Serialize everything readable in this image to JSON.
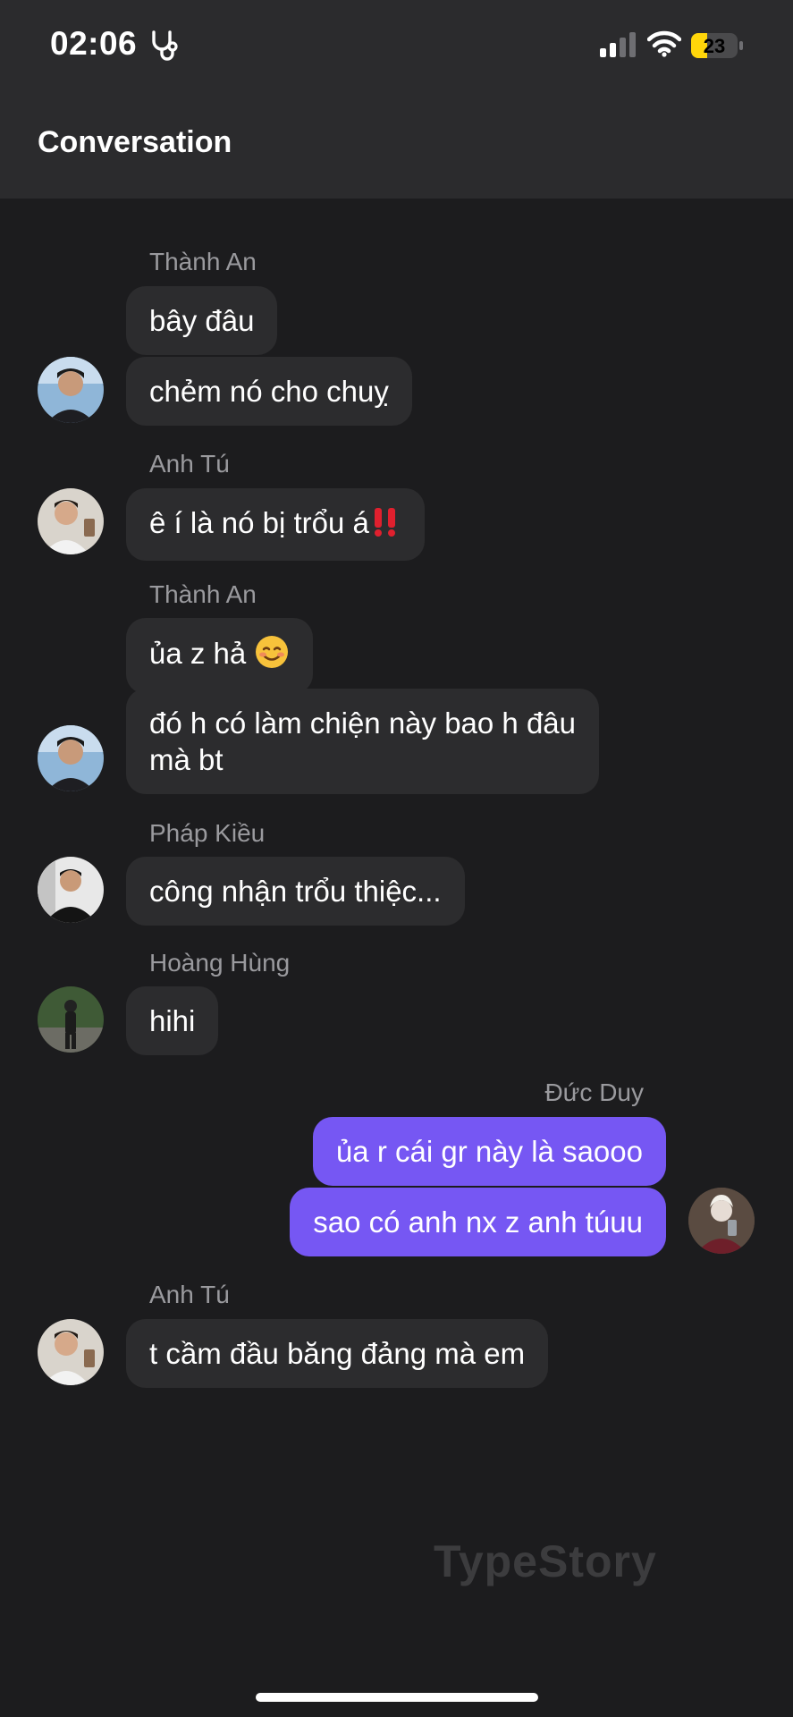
{
  "status_bar": {
    "time": "02:06",
    "battery": "23"
  },
  "header": {
    "title": "Conversation"
  },
  "messages": [
    {
      "sender": "Thành An",
      "text": "bây đâu"
    },
    {
      "text": "chẻm nó cho chuỵ"
    },
    {
      "sender": "Anh Tú",
      "text": "ê í là nó bị trổu á"
    },
    {
      "sender": "Thành An",
      "text": "ủa z hả"
    },
    {
      "line1": "đó h có làm chiện này bao h đâu",
      "line2": "mà bt"
    },
    {
      "sender": "Pháp Kiều",
      "text": "công nhận trổu thiệc..."
    },
    {
      "sender": "Hoàng Hùng",
      "text": "hihi"
    },
    {
      "sender": "Đức Duy",
      "text": "ủa r cái gr này là saooo"
    },
    {
      "text": "sao có anh nx z anh túuu"
    },
    {
      "sender": "Anh Tú",
      "text": "t cầm đầu băng đảng mà em"
    }
  ],
  "watermark": "TypeStory",
  "colors": {
    "background": "#1c1c1e",
    "header": "#2b2b2d",
    "bubble_other": "#2c2c2e",
    "bubble_me": "#7657f3",
    "battery": "#ffd60a"
  },
  "icons": [
    "stethoscope-icon",
    "cellular-signal-icon",
    "wifi-icon",
    "battery-icon",
    "double-exclamation-emoji",
    "smiling-emoji"
  ]
}
